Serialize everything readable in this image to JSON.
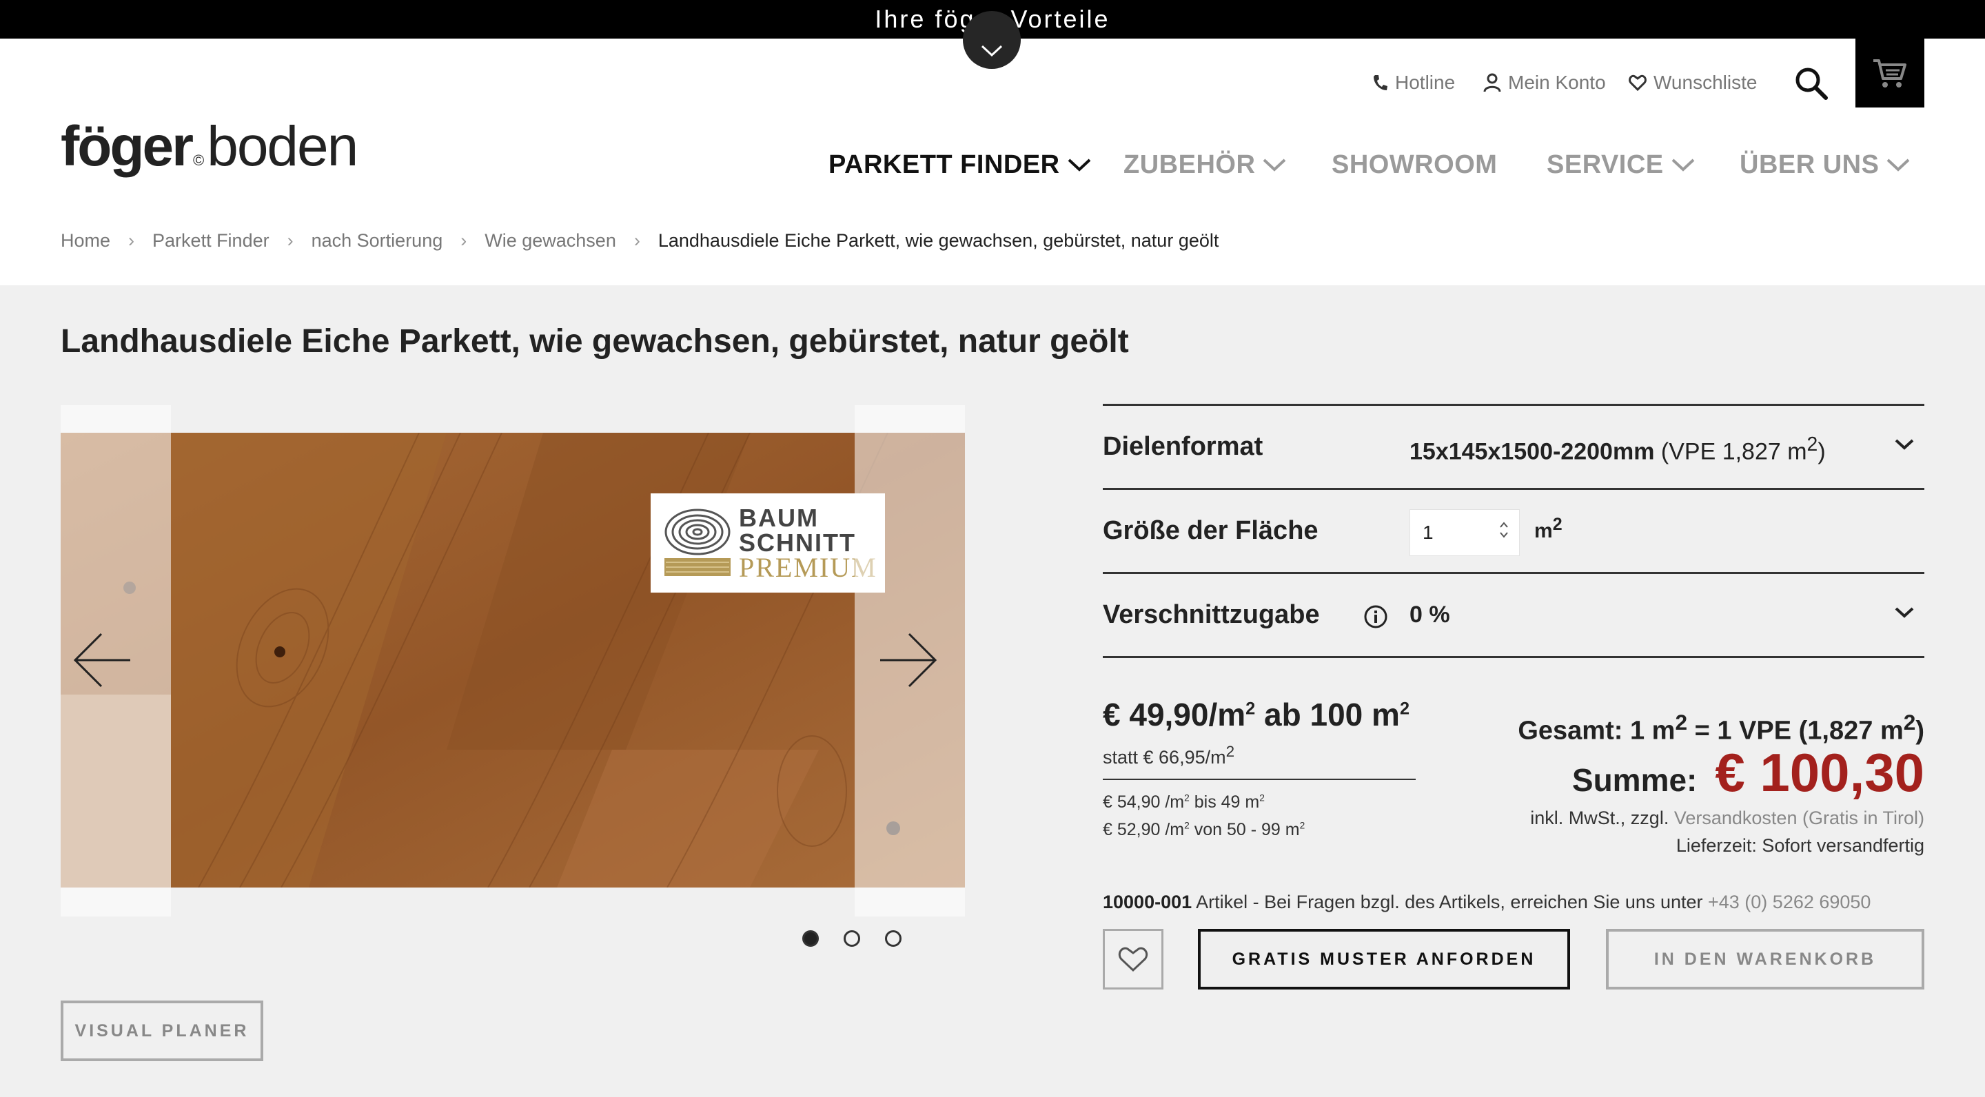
{
  "top_bar": {
    "text": "Ihre föger Vorteile"
  },
  "brand": {
    "logo_part1": "föger",
    "logo_mark": "©",
    "logo_part2": "boden"
  },
  "utility_nav": {
    "hotline": "Hotline",
    "account": "Mein Konto",
    "wishlist": "Wunschliste"
  },
  "main_nav": [
    {
      "label": "PARKETT FINDER",
      "active": true,
      "has_dropdown": true
    },
    {
      "label": "ZUBEHÖR",
      "active": false,
      "has_dropdown": true
    },
    {
      "label": "SHOWROOM",
      "active": false,
      "has_dropdown": false
    },
    {
      "label": "SERVICE",
      "active": false,
      "has_dropdown": true
    },
    {
      "label": "ÜBER UNS",
      "active": false,
      "has_dropdown": true
    }
  ],
  "breadcrumb": {
    "items": [
      "Home",
      "Parkett Finder",
      "nach Sortierung",
      "Wie gewachsen"
    ],
    "separator": "›",
    "current": "Landhausdiele Eiche Parkett, wie gewachsen, gebürstet, natur geölt"
  },
  "product": {
    "title": "Landhausdiele Eiche Parkett, wie gewachsen, gebürstet, natur geölt"
  },
  "gallery": {
    "badge": {
      "line1": "BAUM",
      "line2": "SCHNITT",
      "line3": "PREMIUM"
    },
    "slide_count": 3,
    "active_slide": 1
  },
  "buttons": {
    "visual_planer": "VISUAL PLANER",
    "sample": "GRATIS MUSTER ANFORDEN",
    "add_to_cart": "IN DEN WARENKORB"
  },
  "config": {
    "format_label": "Dielenformat",
    "format_value": "15x145x1500-2200mm",
    "format_vpe": "(VPE 1,827 m",
    "format_vpe_sup": "2",
    "format_vpe_close": ")",
    "area_label": "Größe der Fläche",
    "area_value": "1",
    "area_unit": "m",
    "area_unit_sup": "2",
    "waste_label": "Verschnittzugabe",
    "waste_value": "0 %"
  },
  "pricing": {
    "main_prefix": "€ 49,90/m",
    "main_sup": "2",
    "main_mid": " ab 100 m",
    "main_sup2": "2",
    "strike_prefix": "statt € 66,95/m",
    "strike_sup": "2",
    "tier1_a": "€ 54,90 /m",
    "tier1_sup": "2",
    "tier1_b": " bis 49 m",
    "tier1_sup2": "2",
    "tier2_a": "€ 52,90 /m",
    "tier2_sup": "2",
    "tier2_b": " von 50 - 99 m",
    "tier2_sup2": "2",
    "gesamt_a": "Gesamt: 1 m",
    "gesamt_sup": "2",
    "gesamt_b": " = 1 VPE (1,827 m",
    "gesamt_sup2": "2",
    "gesamt_c": ")",
    "summe_label": "Summe:",
    "summe_value": "€ 100,30",
    "vat_text": "inkl. MwSt., zzgl.",
    "vat_link": "Versandkosten (Gratis in Tirol)",
    "delivery": "Lieferzeit: Sofort versandfertig"
  },
  "article": {
    "number": "10000-001",
    "text": "Artikel - Bei Fragen bzgl. des Artikels, erreichen Sie uns unter",
    "phone": "+43 (0) 5262 69050"
  },
  "colors": {
    "price_red": "#a3211d",
    "wood": "#9b5e2c",
    "nav_active": "#111111",
    "nav_inactive": "#9a9a9a"
  }
}
